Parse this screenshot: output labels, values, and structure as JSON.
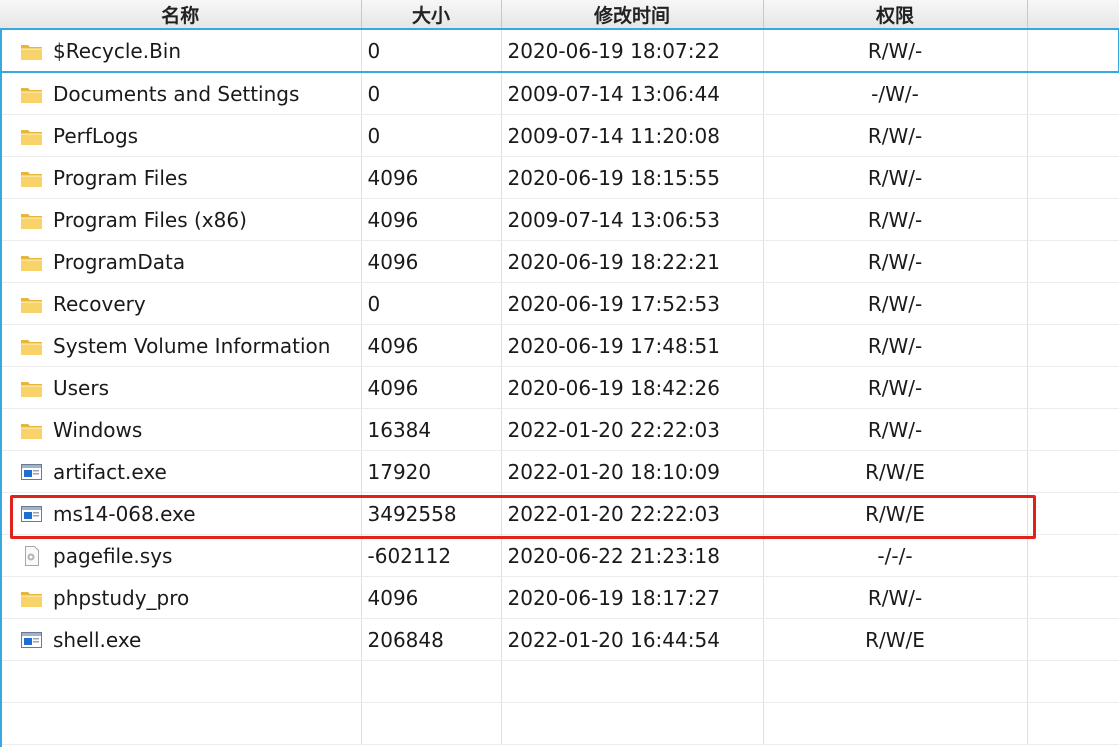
{
  "headers": {
    "name": "名称",
    "size": "大小",
    "modified": "修改时间",
    "permissions": "权限"
  },
  "rows": [
    {
      "name": "$Recycle.Bin",
      "size": "0",
      "modified": "2020-06-19 18:07:22",
      "perm": "R/W/-",
      "icon": "folder-icon"
    },
    {
      "name": "Documents and Settings",
      "size": "0",
      "modified": "2009-07-14 13:06:44",
      "perm": "-/W/-",
      "icon": "folder-icon"
    },
    {
      "name": "PerfLogs",
      "size": "0",
      "modified": "2009-07-14 11:20:08",
      "perm": "R/W/-",
      "icon": "folder-icon"
    },
    {
      "name": "Program Files",
      "size": "4096",
      "modified": "2020-06-19 18:15:55",
      "perm": "R/W/-",
      "icon": "folder-icon"
    },
    {
      "name": "Program Files (x86)",
      "size": "4096",
      "modified": "2009-07-14 13:06:53",
      "perm": "R/W/-",
      "icon": "folder-icon"
    },
    {
      "name": "ProgramData",
      "size": "4096",
      "modified": "2020-06-19 18:22:21",
      "perm": "R/W/-",
      "icon": "folder-icon"
    },
    {
      "name": "Recovery",
      "size": "0",
      "modified": "2020-06-19 17:52:53",
      "perm": "R/W/-",
      "icon": "folder-icon"
    },
    {
      "name": "System Volume Information",
      "size": "4096",
      "modified": "2020-06-19 17:48:51",
      "perm": "R/W/-",
      "icon": "folder-icon"
    },
    {
      "name": "Users",
      "size": "4096",
      "modified": "2020-06-19 18:42:26",
      "perm": "R/W/-",
      "icon": "folder-icon"
    },
    {
      "name": "Windows",
      "size": "16384",
      "modified": "2022-01-20 22:22:03",
      "perm": "R/W/-",
      "icon": "folder-icon"
    },
    {
      "name": "artifact.exe",
      "size": "17920",
      "modified": "2022-01-20 18:10:09",
      "perm": "R/W/E",
      "icon": "executable-icon"
    },
    {
      "name": "ms14-068.exe",
      "size": "3492558",
      "modified": "2022-01-20 22:22:03",
      "perm": "R/W/E",
      "icon": "executable-icon"
    },
    {
      "name": "pagefile.sys",
      "size": "-602112",
      "modified": "2020-06-22 21:23:18",
      "perm": "-/-/-",
      "icon": "system-file-icon"
    },
    {
      "name": "phpstudy_pro",
      "size": "4096",
      "modified": "2020-06-19 18:17:27",
      "perm": "R/W/-",
      "icon": "folder-icon"
    },
    {
      "name": "shell.exe",
      "size": "206848",
      "modified": "2022-01-20 16:44:54",
      "perm": "R/W/E",
      "icon": "executable-icon"
    }
  ],
  "selected_row": 0,
  "highlighted_row": 11,
  "colors": {
    "selection_border": "#39a8e0",
    "highlight_box": "#e3211b",
    "folder": "#f5c542",
    "executable": "#1f6fd1"
  }
}
